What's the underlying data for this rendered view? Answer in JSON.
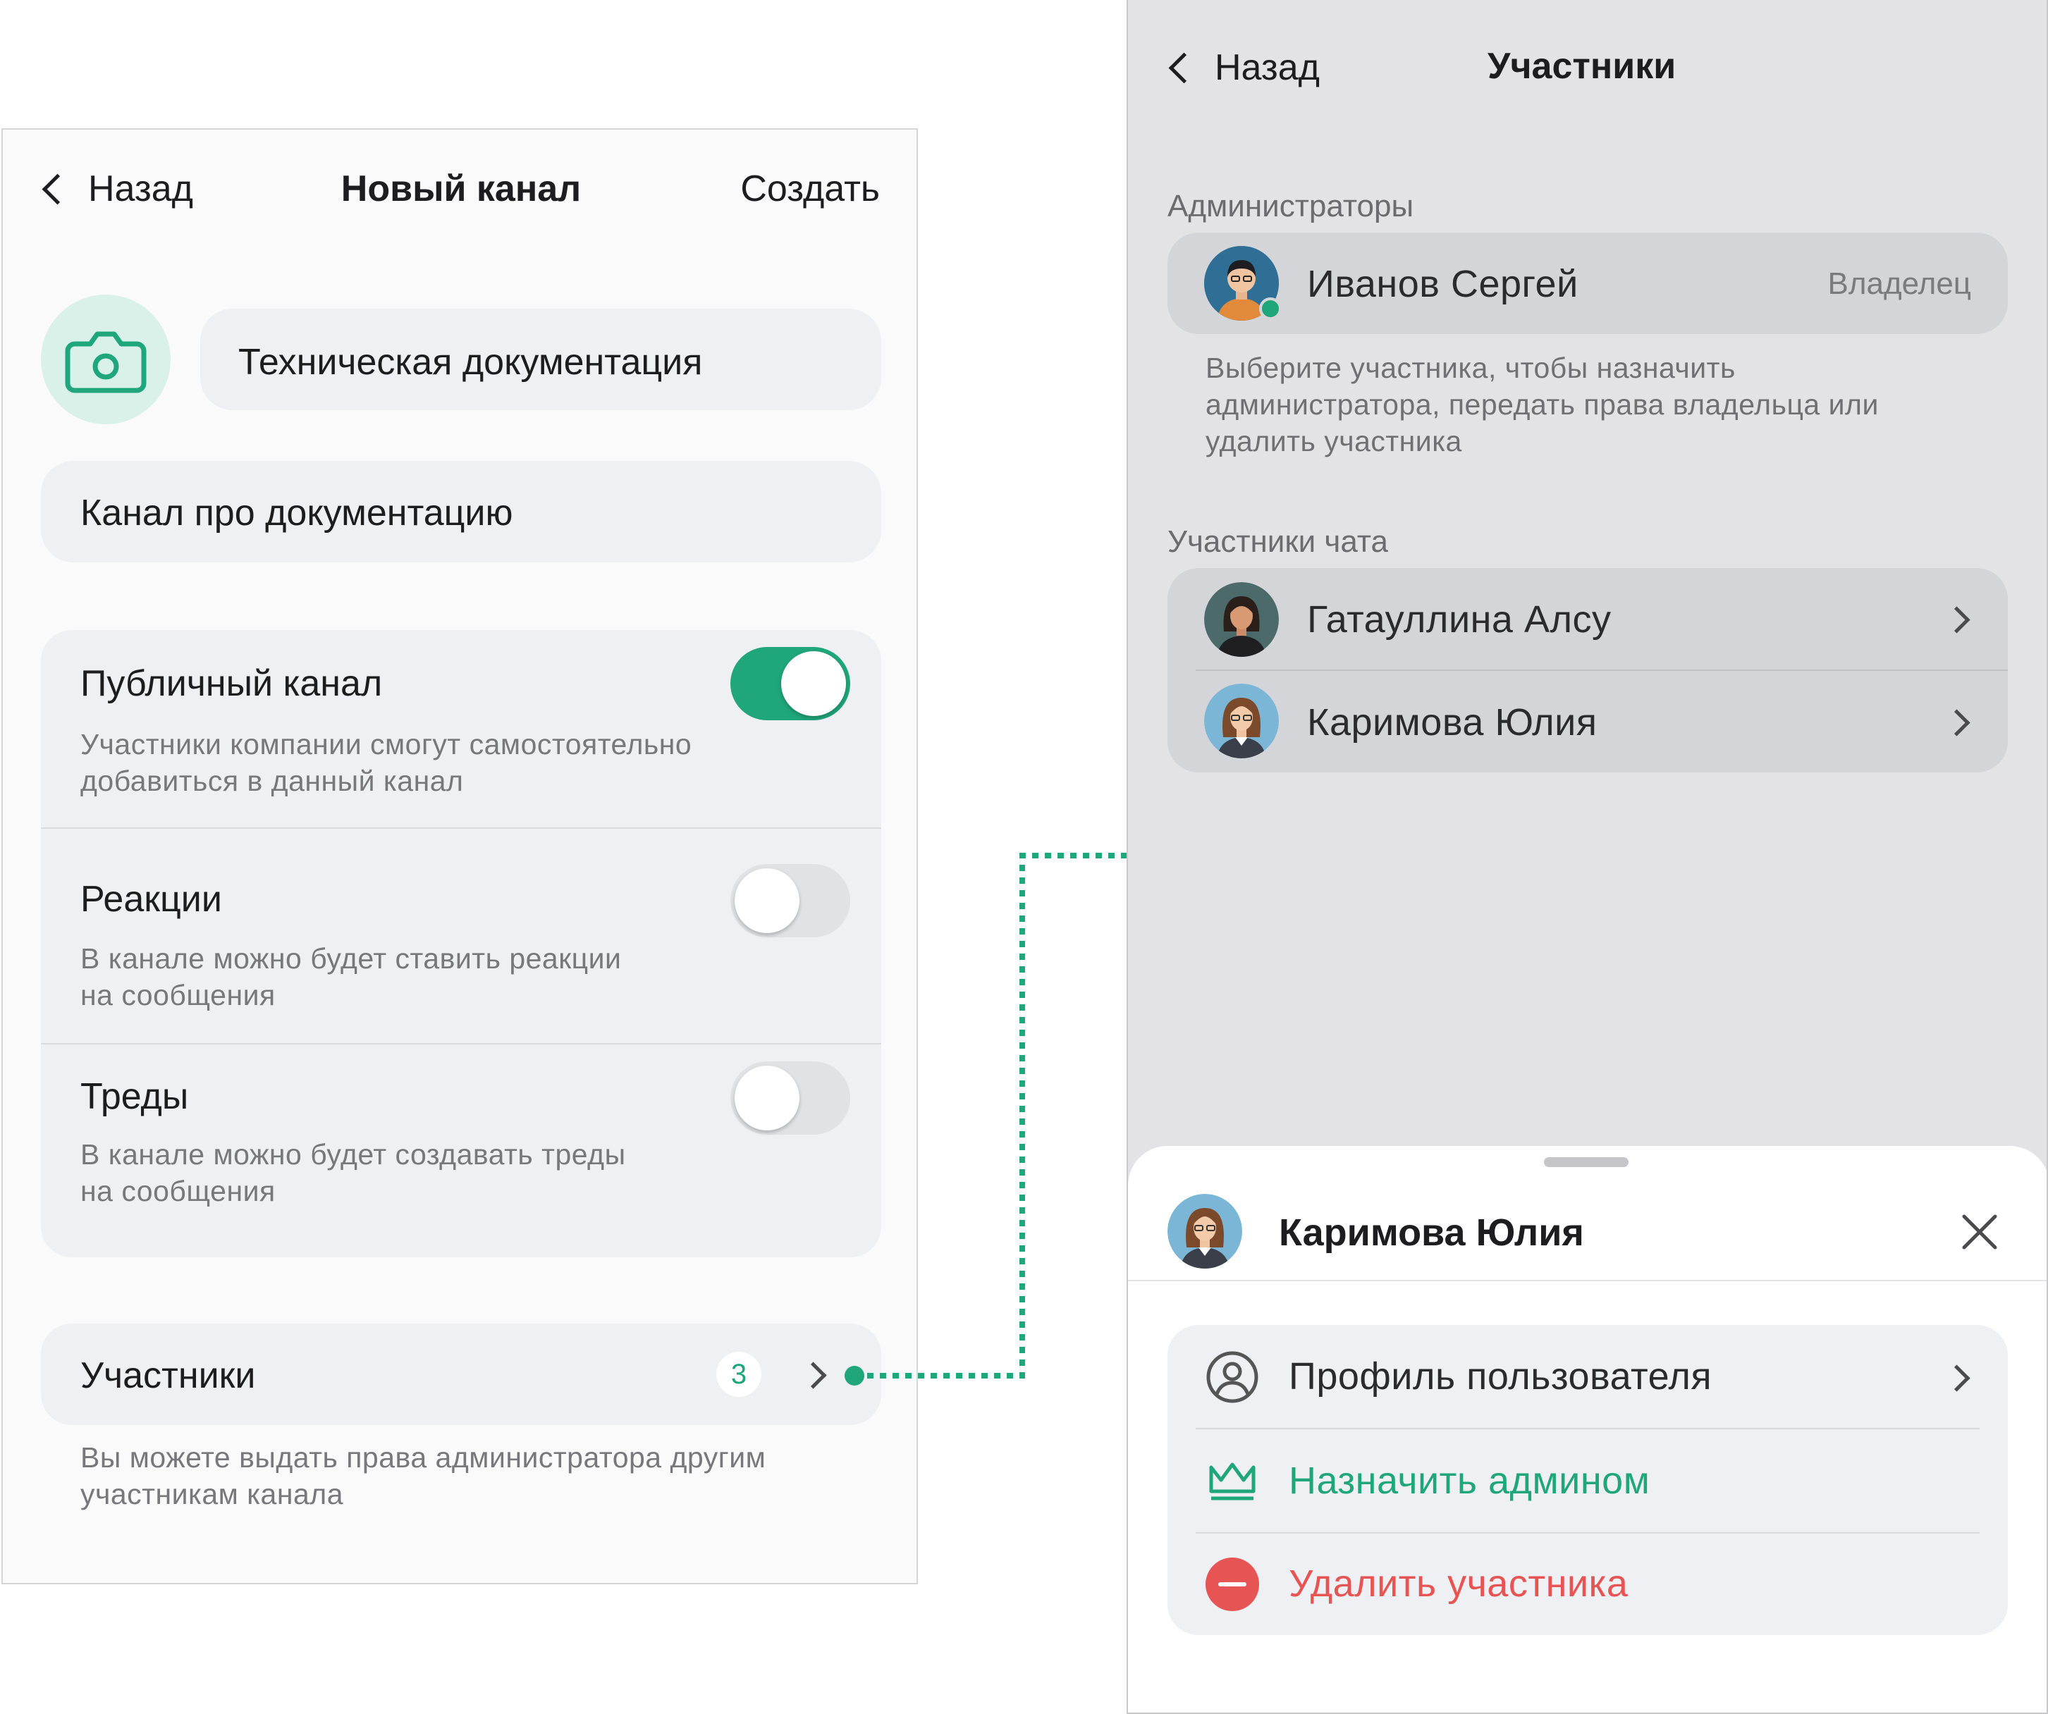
{
  "left": {
    "nav": {
      "back_label": "Назад",
      "title": "Новый канал",
      "action_label": "Создать"
    },
    "channel_name": "Техническая документация",
    "channel_description": "Канал про документацию",
    "settings": [
      {
        "title": "Публичный канал",
        "subtitle_lines": [
          "Участники компании смогут самостоятельно",
          "добавиться в данный канал"
        ],
        "enabled": true
      },
      {
        "title": "Реакции",
        "subtitle_lines": [
          "В канале можно будет ставить реакции",
          "на сообщения"
        ],
        "enabled": false
      },
      {
        "title": "Треды",
        "subtitle_lines": [
          "В канале можно будет создавать треды",
          "на сообщения"
        ],
        "enabled": false
      }
    ],
    "members": {
      "label": "Участники",
      "count": "3"
    },
    "members_hint_lines": [
      "Вы можете выдать права администратора другим",
      "участникам канала"
    ]
  },
  "right": {
    "nav": {
      "back_label": "Назад",
      "title": "Участники"
    },
    "admins_section": "Администраторы",
    "owner": {
      "name": "Иванов Сергей",
      "role": "Владелец"
    },
    "admin_hint_lines": [
      "Выберите участника, чтобы назначить",
      "администратора, передать права владельца или",
      "удалить участника"
    ],
    "members_section": "Участники чата",
    "members": [
      {
        "name": "Гатауллина Алсу"
      },
      {
        "name": "Каримова Юлия"
      }
    ],
    "sheet": {
      "name": "Каримова Юлия",
      "actions": [
        {
          "label": "Профиль пользователя",
          "icon": "user-circle-icon"
        },
        {
          "label": "Назначить админом",
          "icon": "crown-icon"
        },
        {
          "label": "Удалить участника",
          "icon": "minus-circle-icon"
        }
      ]
    }
  },
  "colors": {
    "accent": "#1fa67a",
    "danger": "#e65454",
    "avatar_bg": "#2f6f95"
  }
}
